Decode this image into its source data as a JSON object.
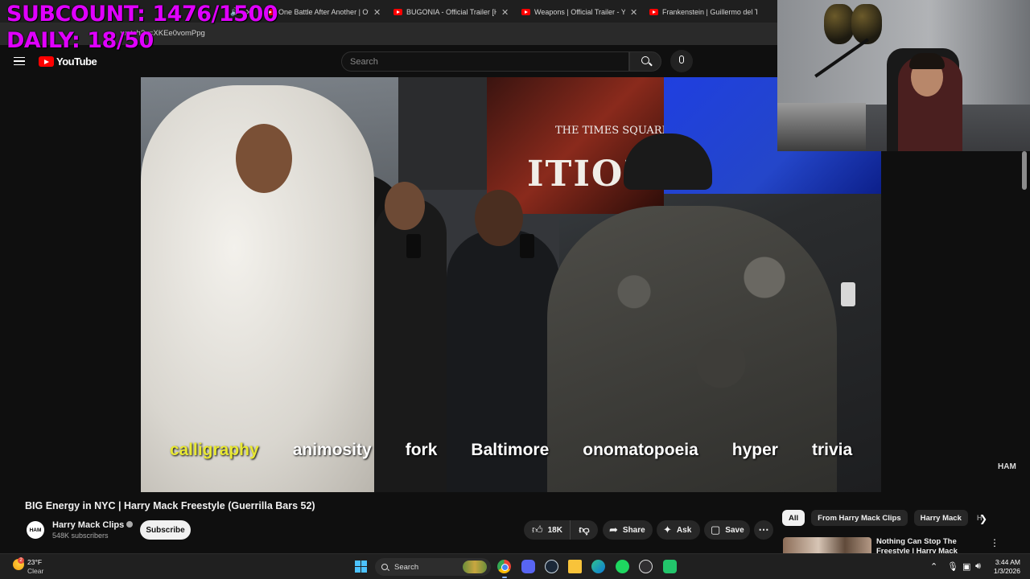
{
  "browser": {
    "tabs": [
      {
        "title": "",
        "has_sound": true
      },
      {
        "title": "One Battle After Another | Offic"
      },
      {
        "title": "BUGONIA - Official Trailer [HD]"
      },
      {
        "title": "Weapons | Official Trailer - YouT"
      },
      {
        "title": "Frankenstein | Guillermo del Tor"
      }
    ],
    "url_fragment": "watch?v=XKEe0vomPpg"
  },
  "stream_overlay": {
    "subcount": "SUBCOUNT: 1476/1500",
    "daily": "DAILY: 18/50",
    "color": "#e000ff"
  },
  "youtube": {
    "logo_text": "YouTube",
    "search_placeholder": "Search",
    "icons": [
      "menu-icon",
      "search-icon",
      "microphone-icon"
    ]
  },
  "video": {
    "captions": [
      "calligraphy",
      "animosity",
      "fork",
      "Baltimore",
      "onomatopoeia",
      "hyper",
      "trivia"
    ],
    "active_caption_index": 0,
    "active_caption_color": "#e8e834",
    "billboard_small": "THE TIMES SQUARE",
    "billboard_big": "ITION",
    "watermark": "HAM"
  },
  "meta": {
    "title": "BIG Energy in NYC | Harry Mack Freestyle (Guerrilla Bars 52)",
    "channel_avatar_text": "HAM",
    "channel_name": "Harry Mack Clips",
    "subscribers": "548K subscribers",
    "subscribe_label": "Subscribe",
    "likes": "18K",
    "share_label": "Share",
    "ask_label": "Ask",
    "save_label": "Save"
  },
  "sidebar": {
    "chips": [
      "All",
      "From Harry Mack Clips",
      "Harry Mack",
      "H"
    ],
    "active_chip_index": 0,
    "recommendation": {
      "title": "Nothing Can Stop The Freestyle | Harry Mack Freestyle (Guerrilla"
    }
  },
  "taskbar": {
    "weather_badge": "2",
    "temperature": "23°F",
    "condition": "Clear",
    "search_label": "Search",
    "time": "3:44 AM",
    "date": "1/3/2026",
    "apps": [
      "chrome-icon",
      "discord-icon",
      "steam-icon",
      "file-explorer-icon",
      "edge-icon",
      "spotify-icon",
      "obs-icon",
      "app-icon"
    ]
  }
}
